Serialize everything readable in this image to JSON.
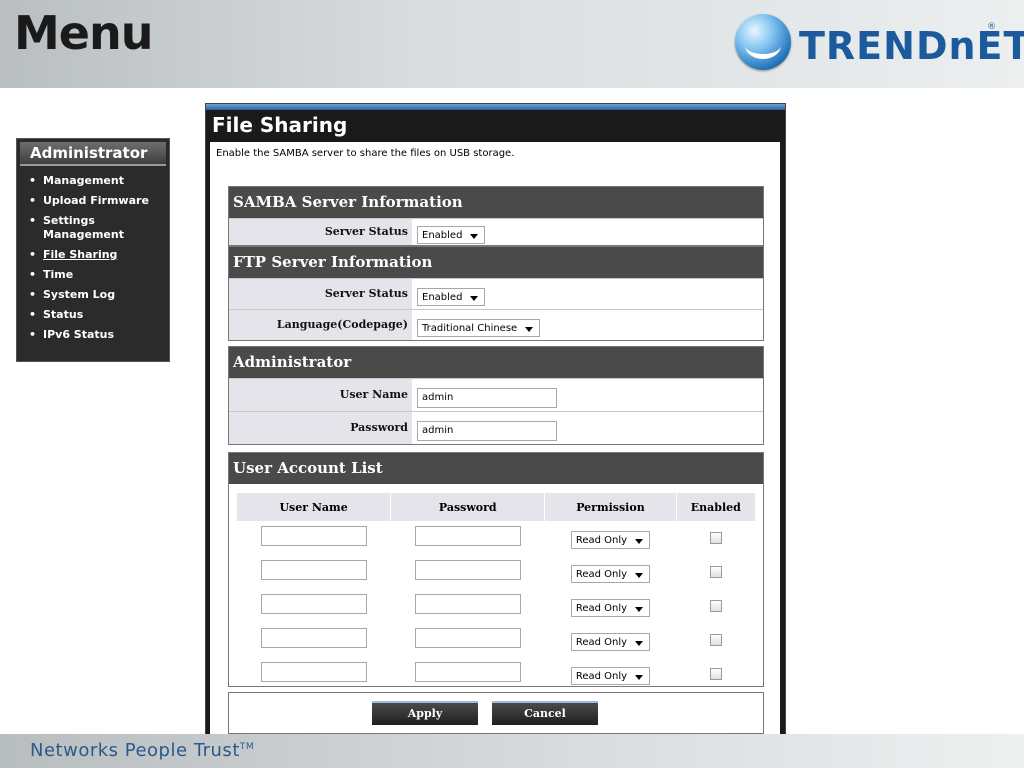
{
  "slide": {
    "title": "Menu",
    "logo_text": "TRENDnET",
    "logo_reg": "®",
    "footer_text": "Networks People Trust",
    "footer_tm": "TM"
  },
  "side_menu": {
    "heading": "Administrator",
    "items": [
      {
        "label": "Management"
      },
      {
        "label": "Upload Firmware"
      },
      {
        "label": "Settings Management"
      },
      {
        "label": "File Sharing",
        "active": true
      },
      {
        "label": "Time"
      },
      {
        "label": "System Log"
      },
      {
        "label": "Status"
      },
      {
        "label": "IPv6 Status"
      }
    ]
  },
  "panel": {
    "title": "File Sharing",
    "description": "Enable the SAMBA server to share the files on USB storage.",
    "samba": {
      "heading": "SAMBA Server Information",
      "server_status_label": "Server Status",
      "server_status_value": "Enabled"
    },
    "ftp": {
      "heading": "FTP Server Information",
      "server_status_label": "Server Status",
      "server_status_value": "Enabled",
      "language_label": "Language(Codepage)",
      "language_value": "Traditional Chinese"
    },
    "admin": {
      "heading": "Administrator",
      "user_name_label": "User Name",
      "user_name_value": "admin",
      "password_label": "Password",
      "password_value": "admin"
    },
    "user_accounts": {
      "heading": "User Account List",
      "columns": [
        "User Name",
        "Password",
        "Permission",
        "Enabled"
      ],
      "rows": [
        {
          "user_name": "",
          "password": "",
          "permission": "Read Only",
          "enabled": false
        },
        {
          "user_name": "",
          "password": "",
          "permission": "Read Only",
          "enabled": false
        },
        {
          "user_name": "",
          "password": "",
          "permission": "Read Only",
          "enabled": false
        },
        {
          "user_name": "",
          "password": "",
          "permission": "Read Only",
          "enabled": false
        },
        {
          "user_name": "",
          "password": "",
          "permission": "Read Only",
          "enabled": false
        }
      ]
    },
    "buttons": {
      "apply": "Apply",
      "cancel": "Cancel"
    }
  }
}
